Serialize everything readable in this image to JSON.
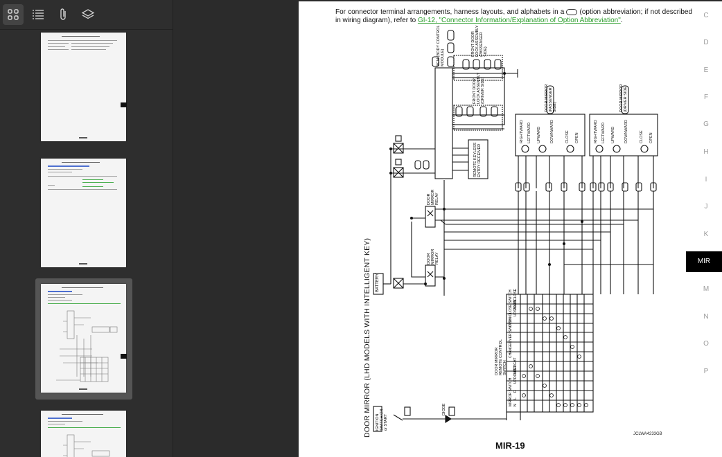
{
  "toolbar": {
    "items": [
      {
        "name": "thumbnails-view-icon",
        "label": "Thumbnails"
      },
      {
        "name": "outline-view-icon",
        "label": "Outline"
      },
      {
        "name": "attachments-icon",
        "label": "Attachments"
      },
      {
        "name": "layers-icon",
        "label": "Layers"
      }
    ]
  },
  "document": {
    "note_prefix": "For connector terminal arrangements, harness layouts, and alphabets in a",
    "note_middle": "(option abbreviation; if not described in wiring diagram), refer to",
    "note_link": "GI-12, \"Connector Information/Explanation of Option Abbreviation\"",
    "note_suffix": ".",
    "diagram_title": "DOOR MIRROR (LHD MODELS WITH INTELLIGENT KEY)",
    "page_number": "MIR-19",
    "diagram_code": "JCLWA4233GB",
    "labels": {
      "bcm": "BCM (BODY CONTROL MODULE)",
      "front_door_lock_actuator_passenger": "FRONT DOOR LOCK ASSEMBLY (PASSENGER SIDE)",
      "front_door_lock_actuator_driver": "FRONT DOOR LOCK ASSEMBLY (DRIVER SIDE)",
      "remote_keyless_entry": "REMOTE KEYLESS ENTRY RECEIVER",
      "door_mirror_passenger": "DOOR MIRROR (PASSENGER SIDE)",
      "door_mirror_driver": "DOOR MIRROR (DRIVER SIDE)",
      "door_mirror_relay_1": "DOOR MIRROR RELAY",
      "door_mirror_relay_2": "DOOR MIRROR RELAY",
      "battery": "BATTERY",
      "ignition_switch": "IGNITION SWITCH ON or START",
      "diode": "DIODE",
      "remote_control_switch": "DOOR MIRROR REMOTE CONTROL SWITCH",
      "motor_labels": [
        "RIGHTWARD",
        "LEFTWARD",
        "UPWARD",
        "DOWNWARD",
        "CLOSE",
        "OPEN"
      ],
      "switch_labels": [
        "OPEN/CLOSE SWITCH",
        "UP/DOWN",
        "CHANGEOVER SWITCH",
        "AUTO",
        "CLOSE",
        "MIRROR SWITCH",
        "N",
        "L",
        "R",
        "UP",
        "DOWN",
        "LEFT",
        "RIGHT"
      ]
    },
    "side_tabs": [
      "C",
      "D",
      "E",
      "F",
      "G",
      "H",
      "I",
      "J",
      "K",
      "MIR",
      "M",
      "N",
      "O",
      "P"
    ],
    "active_tab": "MIR"
  },
  "thumbnails": [
    {
      "title": "DIAGNOSIS SYSTEM (BCM)",
      "page": "MIR-17"
    },
    {
      "title": "ECU DIAGNOSIS INFORMATION",
      "page": "MIR-18"
    },
    {
      "title": "WIRING DIAGRAM",
      "page": "MIR-19"
    },
    {
      "title": "DOOR MIRROR SYSTEM",
      "page": "MIR-20"
    }
  ]
}
